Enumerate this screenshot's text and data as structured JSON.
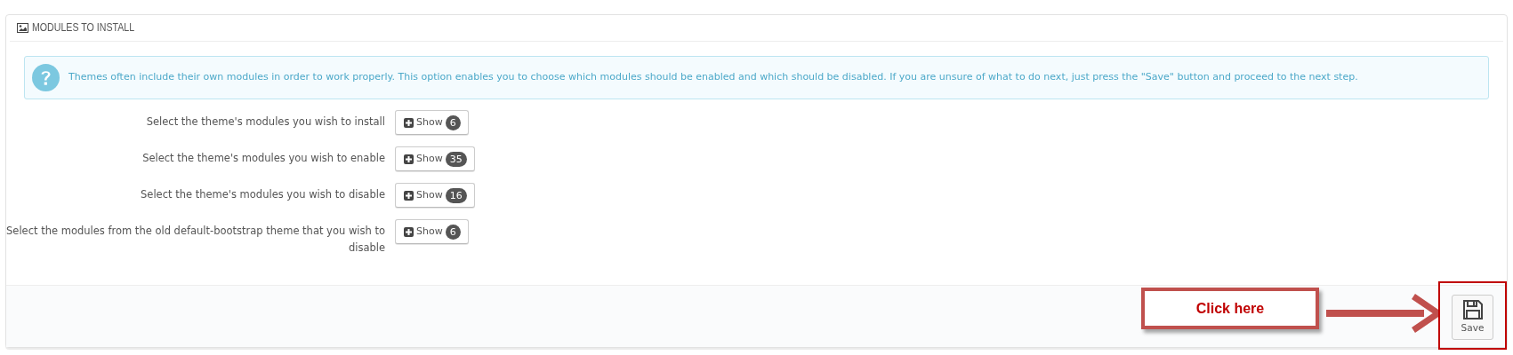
{
  "panel": {
    "title": "MODULES TO INSTALL"
  },
  "alert": {
    "text": "Themes often include their own modules in order to work properly. This option enables you to choose which modules should be enabled and which should be disabled. If you are unsure of what to do next, just press the \"Save\" button and proceed to the next step."
  },
  "rows": [
    {
      "label": "Select the theme's modules you wish to install",
      "button": "Show",
      "count": "6"
    },
    {
      "label": "Select the theme's modules you wish to enable",
      "button": "Show",
      "count": "35"
    },
    {
      "label": "Select the theme's modules you wish to disable",
      "button": "Show",
      "count": "16"
    },
    {
      "label": "Select the modules from the old default-bootstrap theme that you wish to disable",
      "button": "Show",
      "count": "6"
    }
  ],
  "footer": {
    "save_button": "Save"
  },
  "callout": {
    "text": "Click here"
  }
}
